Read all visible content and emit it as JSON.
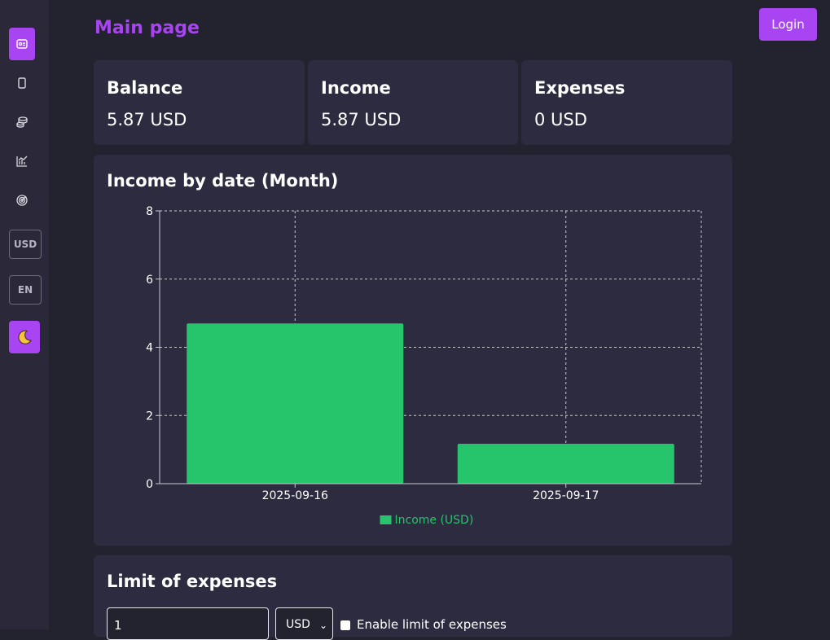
{
  "app": {
    "page_title": "Main page",
    "login_label": "Login"
  },
  "sidebar": {
    "items": [
      {
        "name": "dashboard-icon",
        "active": true
      },
      {
        "name": "wallet-icon",
        "active": false
      },
      {
        "name": "coins-icon",
        "active": false
      },
      {
        "name": "chart-icon",
        "active": false
      },
      {
        "name": "target-icon",
        "active": false
      }
    ],
    "currency_label": "USD",
    "language_label": "EN",
    "theme_icon": "moon-icon"
  },
  "stats": [
    {
      "title": "Balance",
      "value": "5.87 USD"
    },
    {
      "title": "Income",
      "value": "5.87 USD"
    },
    {
      "title": "Expenses",
      "value": "0 USD"
    }
  ],
  "income_chart": {
    "title": "Income by date (Month)"
  },
  "chart_data": {
    "type": "bar",
    "categories": [
      "2025-09-16",
      "2025-09-17"
    ],
    "series": [
      {
        "name": "Income (USD)",
        "values": [
          4.7,
          1.17
        ],
        "color": "#26c46b"
      }
    ],
    "ylim": [
      0,
      8
    ],
    "yticks": [
      0,
      2,
      4,
      6,
      8
    ],
    "grid": true,
    "legend": "bottom"
  },
  "limit": {
    "title": "Limit of expenses",
    "input_value": "1",
    "currency_value": "USD",
    "enable_label": "Enable limit of expenses"
  },
  "colors": {
    "accent": "#a844f2",
    "bar": "#26c46b",
    "card": "#2c2b40",
    "background": "#23222f"
  }
}
